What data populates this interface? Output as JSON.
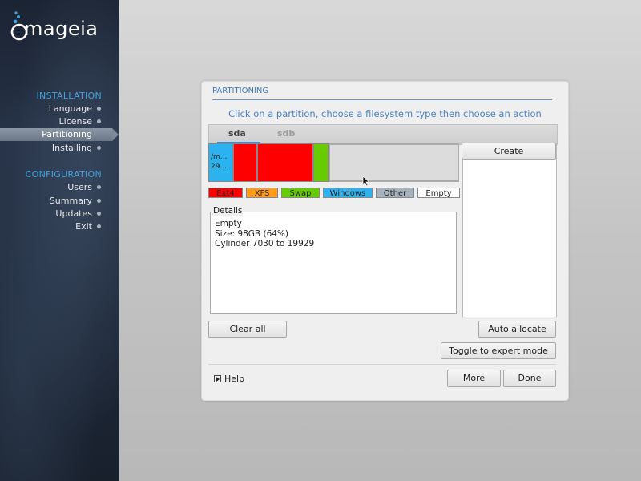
{
  "sidebar": {
    "logo_text": "mageia",
    "sections": [
      {
        "title": "INSTALLATION",
        "items": [
          {
            "label": "Language"
          },
          {
            "label": "License"
          },
          {
            "label": "Partitioning",
            "active": true
          },
          {
            "label": "Installing"
          }
        ]
      },
      {
        "title": "CONFIGURATION",
        "items": [
          {
            "label": "Users"
          },
          {
            "label": "Summary"
          },
          {
            "label": "Updates"
          },
          {
            "label": "Exit"
          }
        ]
      }
    ]
  },
  "dialog": {
    "title": "PARTITIONING",
    "instruction": "Click on a partition, choose a filesystem type then choose an action",
    "tabs": [
      {
        "label": "sda",
        "selected": true
      },
      {
        "label": "sdb",
        "selected": false
      }
    ],
    "partitions": [
      {
        "line1": "/m...",
        "line2": "29...",
        "type": "Windows",
        "color": "#2bb3ef"
      },
      {
        "type": "Ext4",
        "color": "#ff0000"
      },
      {
        "type": "Ext4",
        "color": "#ff0000"
      },
      {
        "type": "Swap",
        "color": "#66cc00"
      },
      {
        "type": "Empty",
        "color": "#dcdcdc",
        "selected": true
      }
    ],
    "legend": [
      {
        "label": "Ext4",
        "color": "#ff0000"
      },
      {
        "label": "XFS",
        "color": "#ff9a1a"
      },
      {
        "label": "Swap",
        "color": "#66cc00"
      },
      {
        "label": "Windows",
        "color": "#2bb3ef"
      },
      {
        "label": "Other",
        "color": "#a8b2bd"
      },
      {
        "label": "Empty",
        "color": "#ffffff"
      }
    ],
    "details": {
      "legend": "Details",
      "lines": [
        "Empty",
        "Size: 98GB (64%)",
        "Cylinder 7030 to 19929"
      ]
    },
    "buttons": {
      "create": "Create",
      "clear_all": "Clear all",
      "auto_allocate": "Auto allocate",
      "toggle_expert": "Toggle to expert mode",
      "more": "More",
      "done": "Done"
    },
    "help": "Help"
  },
  "colors": {
    "accent": "#3fa3e0",
    "title": "#3e7cc1",
    "tab_underline": "#3a8fd8"
  }
}
